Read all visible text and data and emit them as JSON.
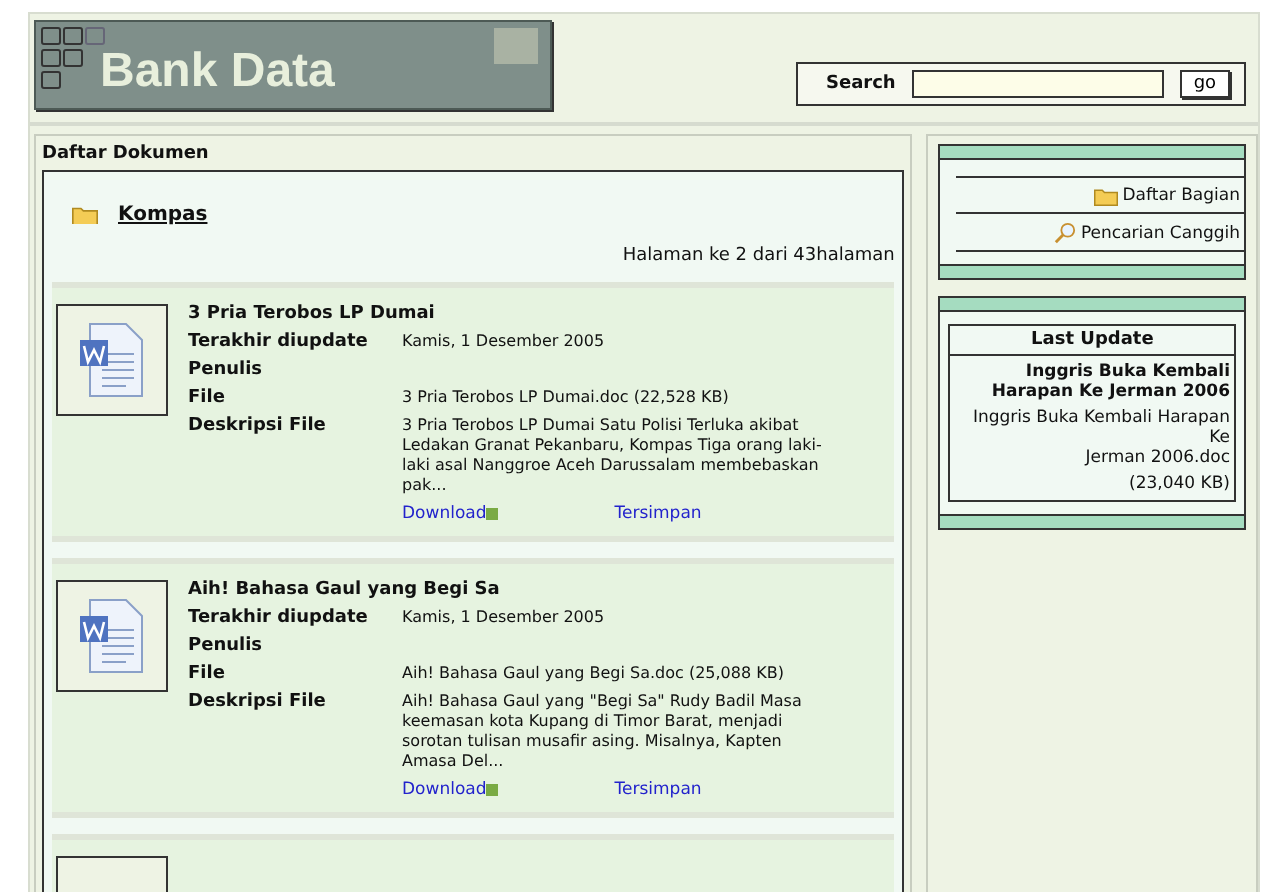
{
  "header": {
    "logo": "Bank Data",
    "search": {
      "label": "Search",
      "button": "go"
    }
  },
  "documents": {
    "title": "Daftar Dokumen",
    "folder": "Kompas",
    "pagination": "Halaman ke 2 dari 43halaman",
    "items": [
      {
        "title": "3 Pria Terobos LP Dumai",
        "fields": [
          {
            "label": "Terakhir diupdate",
            "value": "Kamis, 1 Desember 2005"
          },
          {
            "label": "Penulis"
          },
          {
            "label": "File",
            "value": "3 Pria Terobos LP Dumai.doc (22,528 KB)"
          },
          {
            "label": "Deskripsi File",
            "value": "3 Pria Terobos LP Dumai Satu Polisi Terluka akibat Ledakan Granat Pekanbaru, Kompas Tiga orang laki-laki asal Nanggroe Aceh Darussalam membebaskan pak..."
          }
        ],
        "links": [
          "Download",
          "Tersimpan"
        ]
      },
      {
        "title": "Aih! Bahasa Gaul yang Begi Sa",
        "fields": [
          {
            "label": "Terakhir diupdate",
            "value": "Kamis, 1 Desember 2005"
          },
          {
            "label": "Penulis"
          },
          {
            "label": "File",
            "value": "Aih! Bahasa Gaul yang Begi Sa.doc (25,088 KB)"
          },
          {
            "label": "Deskripsi File",
            "value": "Aih! Bahasa Gaul yang \"Begi Sa\" Rudy Badil Masa keemasan kota Kupang di Timor Barat, menjadi sorotan tulisan musafir asing. Misalnya, Kapten Amasa Del..."
          }
        ],
        "links": [
          "Download",
          "Tersimpan"
        ]
      }
    ]
  },
  "sidebar": {
    "menu": [
      {
        "kind": "folder",
        "label": "Daftar Bagian"
      },
      {
        "kind": "search",
        "label": "Pencarian Canggih"
      }
    ],
    "last_update": {
      "heading": "Last Update",
      "title": "Inggris Buka Kembali Harapan Ke Jerman 2006",
      "file_lines": [
        "Inggris Buka Kembali Harapan",
        "Ke",
        "Jerman 2006.doc"
      ],
      "size": "(23,040 KB)"
    }
  }
}
